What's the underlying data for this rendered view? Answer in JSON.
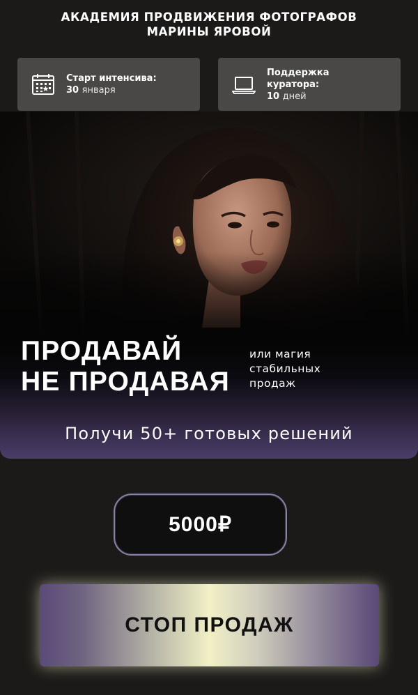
{
  "header": {
    "title_line1": "АКАДЕМИЯ ПРОДВИЖЕНИЯ ФОТОГРАФОВ",
    "title_line2": "МАРИНЫ ЯРОВОЙ"
  },
  "info_cards": {
    "start": {
      "icon": "calendar-icon",
      "label": "Старт интенсива:",
      "value": "30",
      "unit": "января"
    },
    "support": {
      "icon": "laptop-icon",
      "label_line1": "Поддержка",
      "label_line2": "куратора:",
      "value": "10",
      "unit": "дней"
    }
  },
  "hero": {
    "title_line1": "ПРОДАВАЙ",
    "title_line2": "НЕ ПРОДАВАЯ",
    "subtitle_line1": "или магия",
    "subtitle_line2": "стабильных",
    "subtitle_line3": "продаж",
    "offer": "Получи 50+ готовых решений"
  },
  "price": {
    "label": "5000₽"
  },
  "cta": {
    "label": "СТОП ПРОДАЖ"
  },
  "colors": {
    "background": "#1c1a18",
    "card": "#4a4846",
    "purple": "#4b3d6a",
    "gold_highlight": "#f1f0c6"
  }
}
